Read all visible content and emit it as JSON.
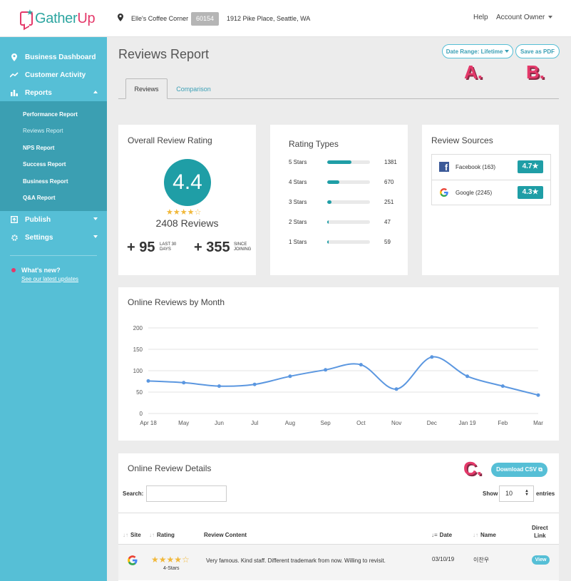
{
  "header": {
    "brand_left": "Gather",
    "brand_right": "Up",
    "business_name": "Elle's Coffee Corner",
    "business_id": "60154",
    "business_address": "1912 Pike Place, Seattle, WA",
    "help": "Help",
    "account": "Account Owner"
  },
  "sidebar": {
    "items": [
      {
        "label": "Business Dashboard",
        "icon": "location-pin-icon"
      },
      {
        "label": "Customer Activity",
        "icon": "trend-line-icon"
      },
      {
        "label": "Reports",
        "icon": "bar-chart-icon"
      },
      {
        "label": "Publish",
        "icon": "publish-icon"
      },
      {
        "label": "Settings",
        "icon": "gear-icon"
      }
    ],
    "report_links": [
      "Performance Report",
      "Reviews Report",
      "NPS Report",
      "Success Report",
      "Business Report",
      "Q&A Report"
    ],
    "whats_new": "What's new?",
    "updates_link": "See our latest updates"
  },
  "page": {
    "title": "Reviews Report",
    "date_range_button": "Date Range: Lifetime",
    "save_pdf_button": "Save as PDF",
    "annotations": [
      "A.",
      "B.",
      "C."
    ],
    "tabs": [
      "Reviews",
      "Comparison"
    ]
  },
  "overall": {
    "title": "Overall Review Rating",
    "rating": "4.4",
    "stars": "★★★★☆",
    "reviews": "2408 Reviews",
    "last30_value": "+ 95",
    "last30_label_1": "LAST 30",
    "last30_label_2": "DAYS",
    "since_value": "+ 355",
    "since_label_1": "SINCE",
    "since_label_2": "JOINING"
  },
  "rating_types": {
    "title": "Rating Types",
    "rows": [
      {
        "label": "5 Stars",
        "count": "1381",
        "fill": 0.57
      },
      {
        "label": "4 Stars",
        "count": "670",
        "fill": 0.28
      },
      {
        "label": "3 Stars",
        "count": "251",
        "fill": 0.1
      },
      {
        "label": "2 Stars",
        "count": "47",
        "fill": 0.02
      },
      {
        "label": "1 Stars",
        "count": "59",
        "fill": 0.02
      }
    ]
  },
  "review_sources": {
    "title": "Review Sources",
    "rows": [
      {
        "name": "Facebook (163)",
        "rating": "4.7★",
        "icon": "facebook-icon"
      },
      {
        "name": "Google (2245)",
        "rating": "4.3★",
        "icon": "google-icon"
      }
    ]
  },
  "chart_data": {
    "type": "line",
    "title": "Online Reviews by Month",
    "categories": [
      "Apr 18",
      "May",
      "Jun",
      "Jul",
      "Aug",
      "Sep",
      "Oct",
      "Nov",
      "Dec",
      "Jan 19",
      "Feb",
      "Mar"
    ],
    "values": [
      76,
      72,
      64,
      68,
      87,
      102,
      114,
      57,
      132,
      87,
      64,
      43
    ],
    "yticks": [
      "200",
      "150",
      "100",
      "50",
      "0"
    ],
    "ylim": [
      0,
      200
    ],
    "grid": true,
    "color": "#5b97e0"
  },
  "details": {
    "title": "Online Review Details",
    "download_csv": "Download CSV",
    "search_label": "Search:",
    "search_value": "",
    "show_label": "Show",
    "show_value": "10",
    "entries_label": "entries",
    "columns": [
      "Site",
      "Rating",
      "Review Content",
      "Date",
      "Name",
      "Direct",
      "Link"
    ],
    "row": {
      "stars": "★★★★☆",
      "rating_label": "4-Stars",
      "content": "Very famous. Kind staff. Different trademark from now. Willing to revisit.",
      "date": "03/10/19",
      "name": "이찬우",
      "link": "View"
    }
  }
}
